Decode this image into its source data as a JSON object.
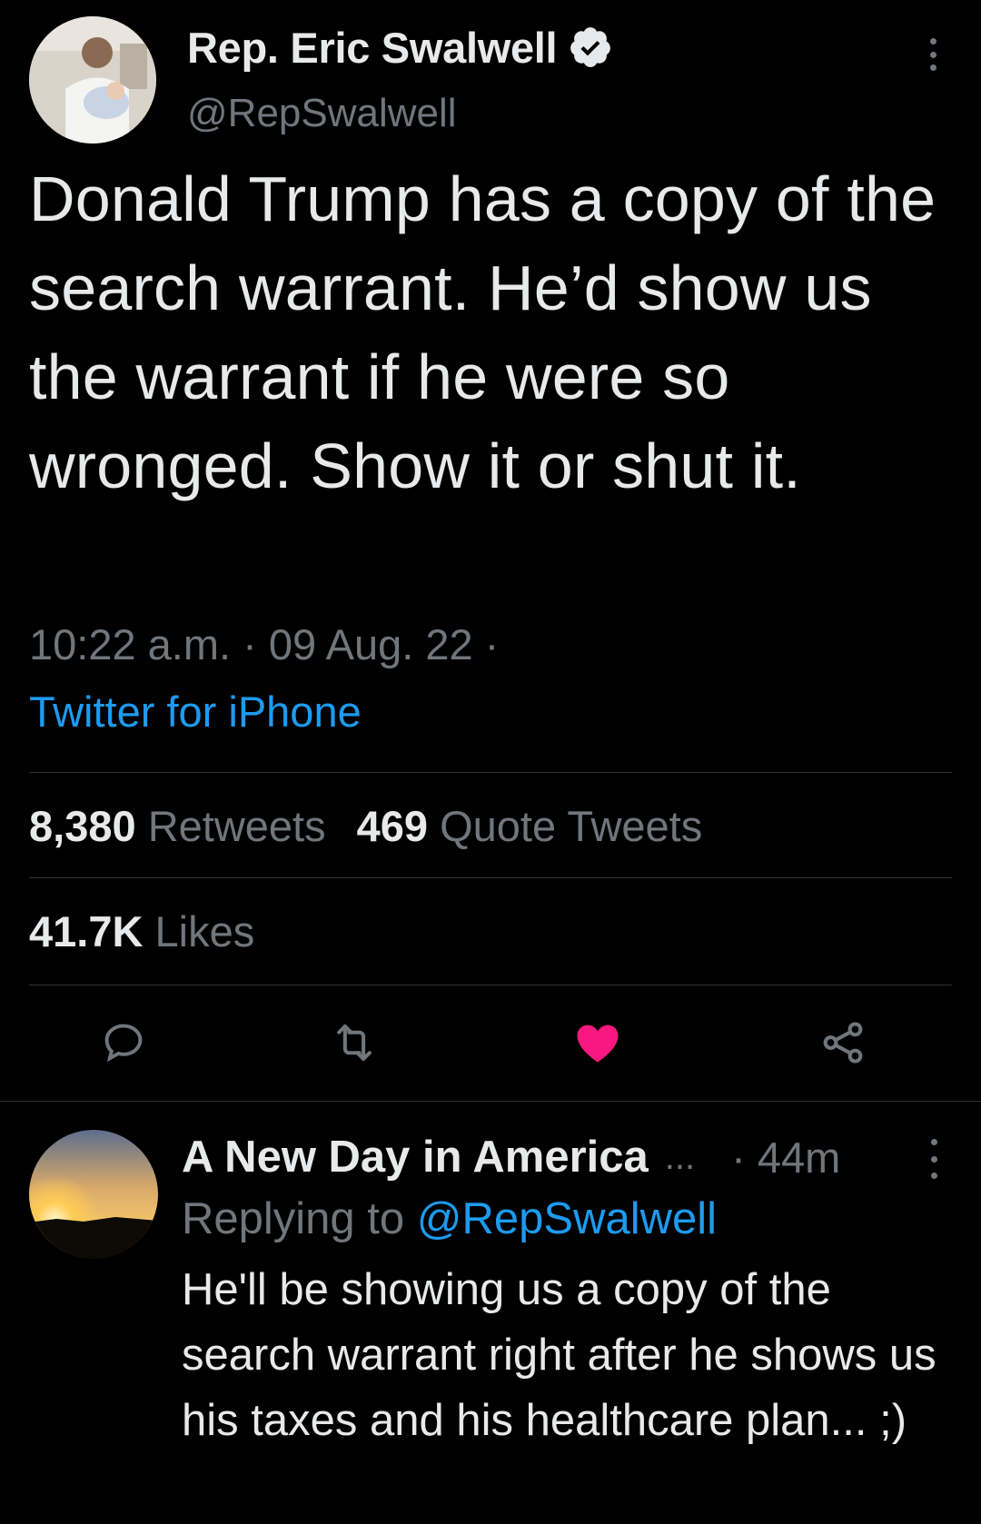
{
  "tweet": {
    "display_name": "Rep. Eric Swalwell",
    "handle": "@RepSwalwell",
    "text": "Donald Trump has a copy of the search warrant. He’d show us the warrant if he were so wronged. Show it or shut it.",
    "time": "10:22 a.m. · 09 Aug. 22 ·",
    "source": "Twitter for iPhone",
    "retweets_count": "8,380",
    "retweets_label": "Retweets",
    "quotes_count": "469",
    "quotes_label": "Quote Tweets",
    "likes_count": "41.7K",
    "likes_label": "Likes",
    "icons": {
      "verified": "verified-badge-icon",
      "more": "more-options-icon",
      "reply": "reply-icon",
      "retweet": "retweet-icon",
      "like": "heart-icon",
      "share": "share-icon"
    }
  },
  "reply": {
    "display_name": "A New Day in America",
    "ellipsis": "...",
    "time": "· 44m",
    "replying_prefix": "Replying to",
    "replying_to": "@RepSwalwell",
    "text": "He'll be showing us a copy of the search warrant right after he shows us his taxes and his healthcare plan... ;)"
  },
  "colors": {
    "background": "#000000",
    "text_primary": "#e7e9ea",
    "text_secondary": "#71767b",
    "link": "#1d9bf0",
    "like_active": "#f91880",
    "divider": "#2f3336"
  }
}
